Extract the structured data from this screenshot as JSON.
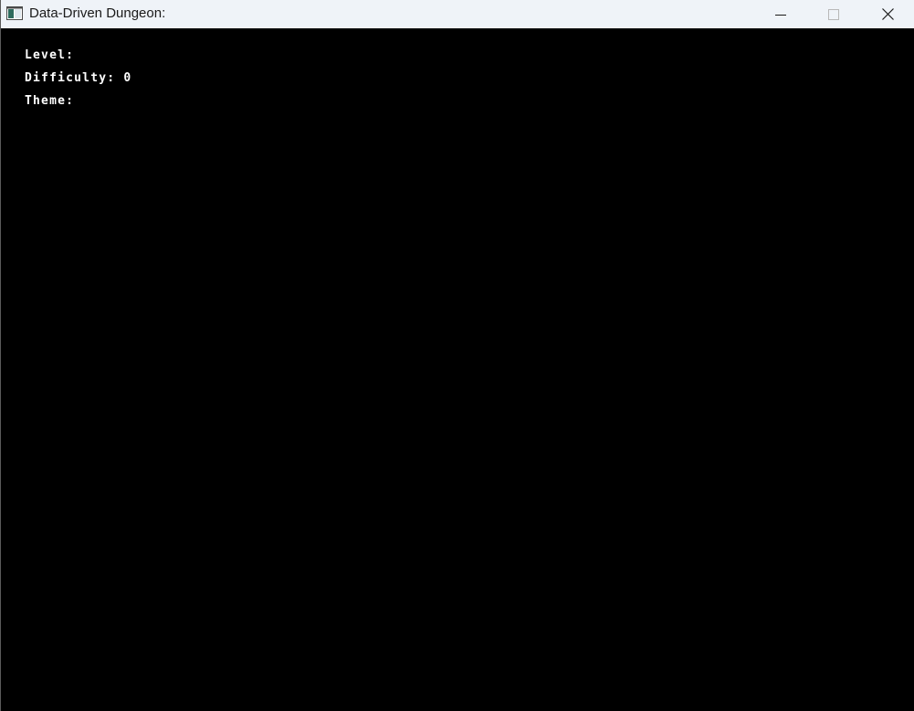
{
  "window": {
    "title": "Data-Driven Dungeon:",
    "icon": "app-window-icon",
    "controls": {
      "minimize_icon": "minimize-icon",
      "maximize_icon": "maximize-icon",
      "close_icon": "close-icon"
    }
  },
  "hud": {
    "level_label": "Level:",
    "level_value": "",
    "difficulty_label": "Difficulty:",
    "difficulty_value": "0",
    "theme_label": "Theme:",
    "theme_value": ""
  },
  "colors": {
    "background": "#000000",
    "text": "#ffffff",
    "titlebar": "#eff3f8"
  }
}
